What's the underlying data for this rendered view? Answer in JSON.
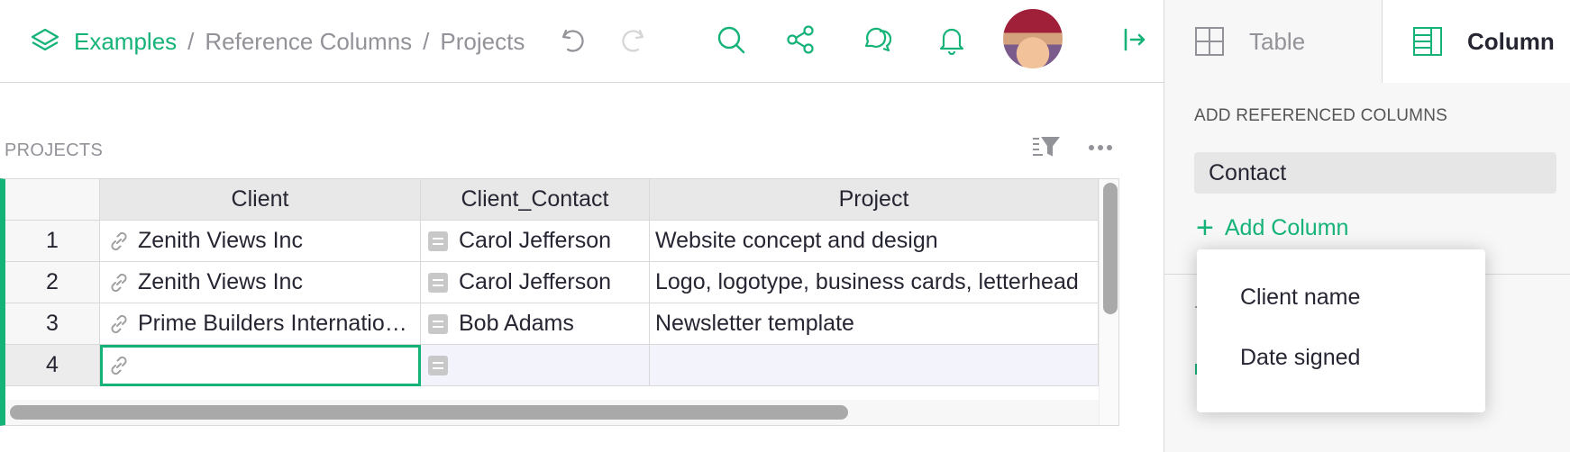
{
  "breadcrumb": {
    "org": "Examples",
    "sep1": "/",
    "doc": "Reference Columns",
    "sep2": "/",
    "page": "Projects"
  },
  "toolbar_icons": [
    "undo-icon",
    "redo-icon",
    "search-icon",
    "share-icon",
    "comments-icon",
    "notifications-icon",
    "avatar",
    "collapse-panel-icon"
  ],
  "right_panel": {
    "tabs": [
      {
        "label": "Table",
        "icon": "table-icon",
        "active": false
      },
      {
        "label": "Column",
        "icon": "column-icon",
        "active": true
      }
    ],
    "section_title": "ADD REFERENCED COLUMNS",
    "referenced_column": "Contact",
    "add_column_label": "Add Column",
    "add_column_symbol": "+",
    "menu_items": [
      "Client name",
      "Date signed"
    ]
  },
  "section": {
    "title": "PROJECTS"
  },
  "table": {
    "columns": [
      "Client",
      "Client_Contact",
      "Project"
    ],
    "rows": [
      {
        "num": "1",
        "client": "Zenith Views Inc",
        "contact": "Carol Jefferson",
        "project": "Website concept and design"
      },
      {
        "num": "2",
        "client": "Zenith Views Inc",
        "contact": "Carol Jefferson",
        "project": "Logo, logotype, business cards, letterhead"
      },
      {
        "num": "3",
        "client": "Prime Builders International",
        "contact": "Bob Adams",
        "project": "Newsletter template"
      }
    ],
    "new_row_num": "4"
  },
  "colors": {
    "accent": "#16b378",
    "muted": "#929299",
    "cursor": "#16b378"
  }
}
